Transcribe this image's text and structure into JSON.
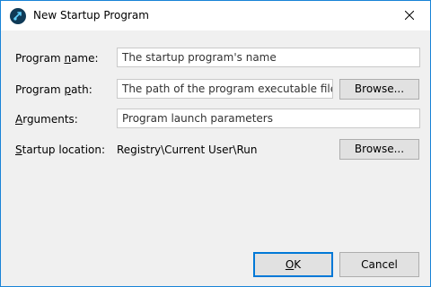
{
  "window": {
    "title": "New Startup Program"
  },
  "form": {
    "program_name": {
      "label_pre": "Program ",
      "label_key": "n",
      "label_post": "ame:",
      "placeholder": "The startup program's name"
    },
    "program_path": {
      "label_pre": "Program ",
      "label_key": "p",
      "label_post": "ath:",
      "placeholder": "The path of the program executable file",
      "browse_label": "Browse..."
    },
    "arguments": {
      "label_pre": "",
      "label_key": "A",
      "label_post": "rguments:",
      "placeholder": "Program launch parameters"
    },
    "startup_location": {
      "label_pre": "",
      "label_key": "S",
      "label_post": "tartup location:",
      "value": "Registry\\Current User\\Run",
      "browse_label": "Browse..."
    }
  },
  "buttons": {
    "ok_key": "O",
    "ok_rest": "K",
    "cancel": "Cancel"
  },
  "colors": {
    "accent": "#0078d7",
    "window_border": "#1883d7"
  }
}
